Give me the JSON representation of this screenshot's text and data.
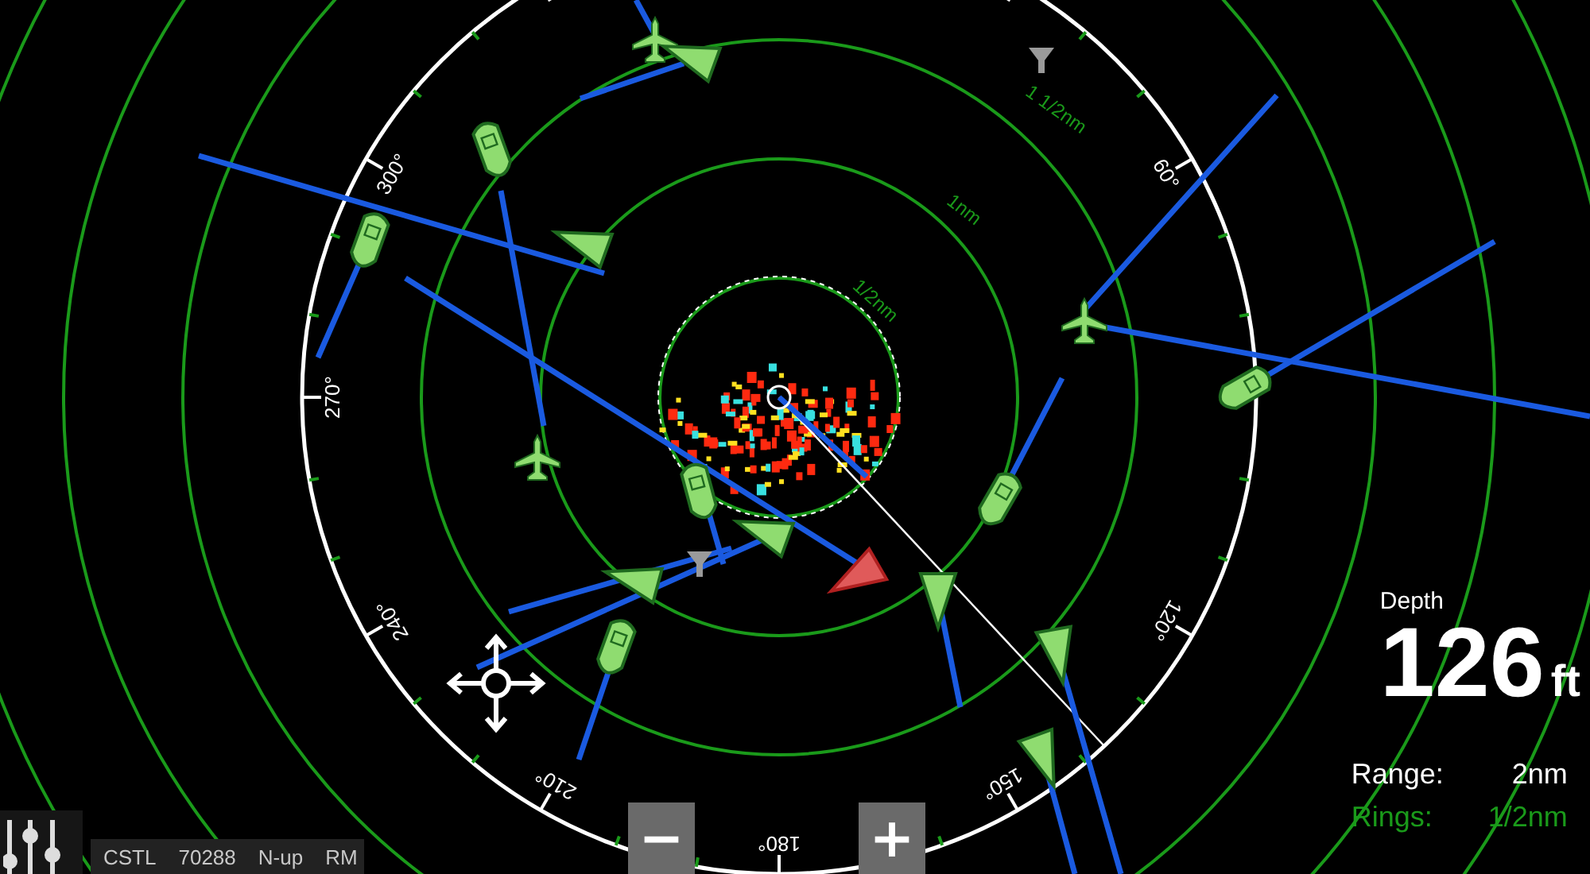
{
  "range_rings": [
    {
      "label": "1/2nm"
    },
    {
      "label": "1nm"
    },
    {
      "label": "1 1/2nm"
    }
  ],
  "bearings": [
    "270°",
    "300°",
    "60°",
    "240°",
    "120°",
    "210°",
    "150°",
    "180°"
  ],
  "targets": [
    {
      "kind": "aircraft",
      "dangerous": false
    },
    {
      "kind": "ship",
      "dangerous": false
    },
    {
      "kind": "boat",
      "dangerous": false
    },
    {
      "kind": "ship",
      "dangerous": false
    },
    {
      "kind": "boat",
      "dangerous": false
    },
    {
      "kind": "aircraft",
      "dangerous": false
    },
    {
      "kind": "aircraft",
      "dangerous": false
    },
    {
      "kind": "boat",
      "dangerous": false
    },
    {
      "kind": "boat",
      "dangerous": false
    },
    {
      "kind": "ship",
      "dangerous": false
    },
    {
      "kind": "ship",
      "dangerous": true
    },
    {
      "kind": "ship",
      "dangerous": false
    },
    {
      "kind": "boat",
      "dangerous": false
    },
    {
      "kind": "boat",
      "dangerous": false
    },
    {
      "kind": "ship",
      "dangerous": false
    },
    {
      "kind": "ship",
      "dangerous": false
    },
    {
      "kind": "ship",
      "dangerous": false
    }
  ],
  "status_bar": [
    "CSTL",
    "70288",
    "N-up",
    "RM"
  ],
  "zoom_out": "−",
  "zoom_in": "+",
  "depth": {
    "label": "Depth",
    "value": "126",
    "unit": "ft"
  },
  "range": {
    "label": "Range:",
    "value": "2nm"
  },
  "rings": {
    "label": "Rings:",
    "value": "1/2nm"
  }
}
